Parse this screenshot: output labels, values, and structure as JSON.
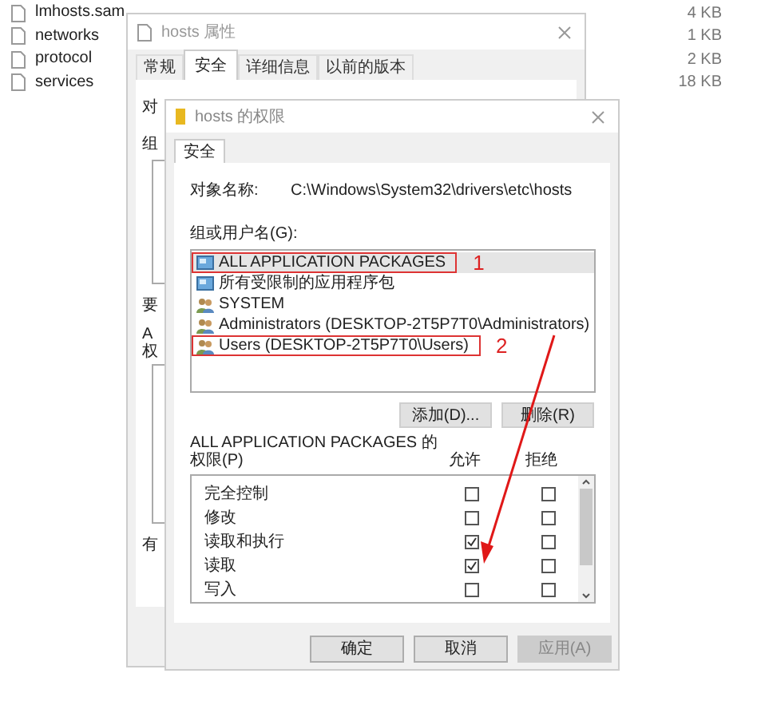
{
  "file_list": [
    {
      "name": "lmhosts.sam",
      "size": "4 KB"
    },
    {
      "name": "networks",
      "size": "1 KB"
    },
    {
      "name": "protocol",
      "size": "2 KB"
    },
    {
      "name": "services",
      "size": "18 KB"
    }
  ],
  "properties_window": {
    "title": "hosts 属性",
    "tabs": [
      {
        "label": "常规",
        "selected": false
      },
      {
        "label": "安全",
        "selected": true
      },
      {
        "label": "详细信息",
        "selected": false
      },
      {
        "label": "以前的版本",
        "selected": false
      }
    ],
    "partial_labels": [
      "对",
      "组",
      "要",
      "A",
      "权",
      "有"
    ]
  },
  "permissions_window": {
    "title": "hosts 的权限",
    "tabs": [
      {
        "label": "安全",
        "selected": true
      }
    ],
    "object_label": "对象名称:",
    "object_value": "C:\\Windows\\System32\\drivers\\etc\\hosts",
    "group_label": "组或用户名(G):",
    "groups": [
      {
        "name": "ALL APPLICATION PACKAGES",
        "kind": "package",
        "selected": true,
        "callout": "1"
      },
      {
        "name": "所有受限制的应用程序包",
        "kind": "package",
        "selected": false
      },
      {
        "name": "SYSTEM",
        "kind": "users",
        "selected": false
      },
      {
        "name": "Administrators (DESKTOP-2T5P7T0\\Administrators)",
        "kind": "users",
        "selected": false
      },
      {
        "name": "Users (DESKTOP-2T5P7T0\\Users)",
        "kind": "users",
        "selected": false,
        "callout": "2"
      }
    ],
    "add_button": "添加(D)...",
    "remove_button": "删除(R)",
    "permissions_label_1": "ALL APPLICATION PACKAGES 的",
    "permissions_label_2": "权限(P)",
    "allow_header": "允许",
    "deny_header": "拒绝",
    "permissions": [
      {
        "name": "完全控制",
        "allow": false,
        "deny": false
      },
      {
        "name": "修改",
        "allow": false,
        "deny": false
      },
      {
        "name": "读取和执行",
        "allow": true,
        "deny": false
      },
      {
        "name": "读取",
        "allow": true,
        "deny": false
      },
      {
        "name": "写入",
        "allow": false,
        "deny": false
      }
    ],
    "buttons": [
      {
        "label": "确定",
        "disabled": false
      },
      {
        "label": "取消",
        "disabled": false
      },
      {
        "label": "应用(A)",
        "disabled": true
      }
    ]
  }
}
